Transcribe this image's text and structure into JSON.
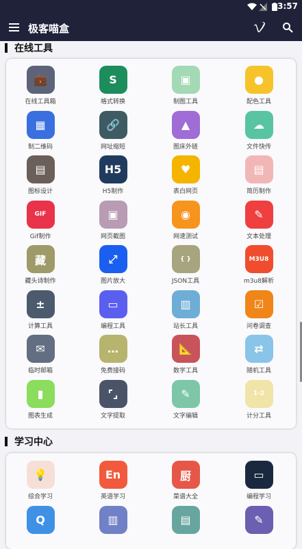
{
  "status": {
    "time": "3:57"
  },
  "appbar": {
    "title": "极客喵盒"
  },
  "sections": [
    {
      "title": "在线工具"
    },
    {
      "title": "学习中心"
    }
  ],
  "tools": [
    {
      "label": "在线工具箱",
      "color": "#5d6479",
      "glyph": "💼",
      "icon": "briefcase-icon"
    },
    {
      "label": "格式转换",
      "color": "#1d8d5e",
      "glyph": "S",
      "icon": "convert-icon"
    },
    {
      "label": "制图工具",
      "color": "#a3d9b4",
      "glyph": "▣",
      "icon": "image-tool-icon"
    },
    {
      "label": "配色工具",
      "color": "#f6c32a",
      "glyph": "●",
      "icon": "palette-icon"
    },
    {
      "label": "制二维码",
      "color": "#3a6fe0",
      "glyph": "▦",
      "icon": "qrcode-icon"
    },
    {
      "label": "网址缩短",
      "color": "#3e5b63",
      "glyph": "🔗",
      "icon": "link-icon"
    },
    {
      "label": "图床外链",
      "color": "#a06cd5",
      "glyph": "▲",
      "icon": "gallery-icon"
    },
    {
      "label": "文件快传",
      "color": "#58c4a2",
      "glyph": "☁",
      "icon": "cloud-upload-icon"
    },
    {
      "label": "图标设计",
      "color": "#6b5f5a",
      "glyph": "▤",
      "icon": "icon-design-icon"
    },
    {
      "label": "H5制作",
      "color": "#203b5d",
      "glyph": "H5",
      "icon": "h5-icon"
    },
    {
      "label": "表白网页",
      "color": "#f4b400",
      "glyph": "♥",
      "icon": "heart-icon"
    },
    {
      "label": "简历制作",
      "color": "#f1b7b7",
      "glyph": "▤",
      "icon": "resume-icon"
    },
    {
      "label": "Gif制作",
      "color": "#e8334a",
      "glyph": "GIF",
      "icon": "gif-icon"
    },
    {
      "label": "网页截图",
      "color": "#b99bb3",
      "glyph": "▣",
      "icon": "screenshot-icon"
    },
    {
      "label": "网速测试",
      "color": "#f7941d",
      "glyph": "◉",
      "icon": "speedtest-icon"
    },
    {
      "label": "文本处理",
      "color": "#ef3f3f",
      "glyph": "✎",
      "icon": "text-edit-icon"
    },
    {
      "label": "藏头诗制作",
      "color": "#9e9a69",
      "glyph": "藏",
      "icon": "poem-icon"
    },
    {
      "label": "图片放大",
      "color": "#1b5ff0",
      "glyph": "⤢",
      "icon": "enlarge-icon"
    },
    {
      "label": "JSON工具",
      "color": "#a7a57f",
      "glyph": "{ }",
      "icon": "json-icon"
    },
    {
      "label": "m3u8解析",
      "color": "#ef4d2d",
      "glyph": "M3U8",
      "icon": "m3u8-icon"
    },
    {
      "label": "计算工具",
      "color": "#4c5a6e",
      "glyph": "±",
      "icon": "calculator-icon"
    },
    {
      "label": "编程工具",
      "color": "#5b5ff0",
      "glyph": "▭",
      "icon": "monitor-icon"
    },
    {
      "label": "站长工具",
      "color": "#6eaed6",
      "glyph": "▥",
      "icon": "webmaster-icon"
    },
    {
      "label": "问卷调查",
      "color": "#f08519",
      "glyph": "☑",
      "icon": "survey-icon"
    },
    {
      "label": "临时邮箱",
      "color": "#626e82",
      "glyph": "✉",
      "icon": "mail-icon"
    },
    {
      "label": "免费接码",
      "color": "#b7b46d",
      "glyph": "…",
      "icon": "sms-icon"
    },
    {
      "label": "数学工具",
      "color": "#c9535a",
      "glyph": "📐",
      "icon": "math-icon"
    },
    {
      "label": "随机工具",
      "color": "#8ac4e8",
      "glyph": "⇄",
      "icon": "shuffle-icon"
    },
    {
      "label": "图表生成",
      "color": "#8cdc5e",
      "glyph": "▮",
      "icon": "chart-gen-icon"
    },
    {
      "label": "文字提取",
      "color": "#4a5468",
      "glyph": "⌜⌟",
      "icon": "ocr-icon"
    },
    {
      "label": "文字编辑",
      "color": "#7dc7a8",
      "glyph": "✎",
      "icon": "text-editor-icon"
    },
    {
      "label": "计分工具",
      "color": "#f1e4a8",
      "glyph": "1-2",
      "icon": "score-icon"
    }
  ],
  "learning": [
    {
      "label": "综合学习",
      "color": "#f6e0d6",
      "glyph": "💡",
      "icon": "bulb-icon"
    },
    {
      "label": "英语学习",
      "color": "#f15a3c",
      "glyph": "En",
      "icon": "english-icon"
    },
    {
      "label": "菜谱大全",
      "color": "#e75748",
      "glyph": "厨",
      "icon": "recipe-icon"
    },
    {
      "label": "编程学习",
      "color": "#1b2940",
      "glyph": "▭",
      "icon": "laptop-icon"
    },
    {
      "label": "",
      "color": "#3f91e6",
      "glyph": "Q",
      "icon": "search-learn-icon"
    },
    {
      "label": "",
      "color": "#7081c7",
      "glyph": "▥",
      "icon": "books-icon"
    },
    {
      "label": "",
      "color": "#67a69f",
      "glyph": "▤",
      "icon": "clipboard-icon"
    },
    {
      "label": "",
      "color": "#6a5fb0",
      "glyph": "✎",
      "icon": "notes-icon"
    }
  ]
}
